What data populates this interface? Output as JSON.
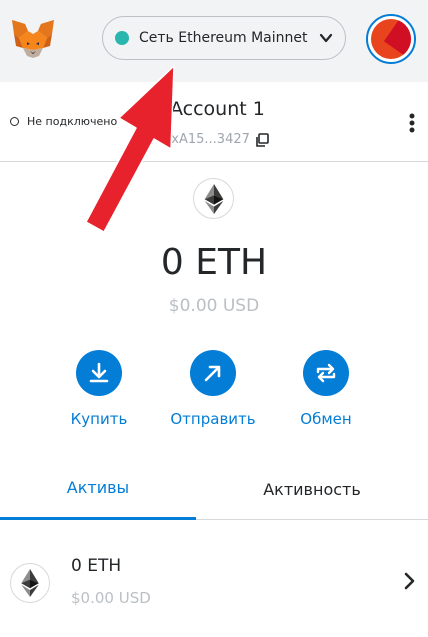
{
  "header": {
    "network_label": "Сеть Ethereum Mainnet",
    "network_dot_color": "#29b6af"
  },
  "account": {
    "connection_status": "Не подключено",
    "name": "Account 1",
    "address_short": "0xA15...3427"
  },
  "balance": {
    "primary": "0 ETH",
    "secondary": "$0.00 USD"
  },
  "actions": {
    "buy_label": "Купить",
    "send_label": "Отправить",
    "swap_label": "Обмен"
  },
  "tabs": {
    "assets_label": "Активы",
    "activity_label": "Активность",
    "selected": "assets"
  },
  "assets": [
    {
      "amount": "0 ETH",
      "fiat": "$0.00 USD",
      "icon": "ethereum-icon"
    }
  ],
  "colors": {
    "accent": "#037dd6",
    "annotation": "#e8222c"
  }
}
